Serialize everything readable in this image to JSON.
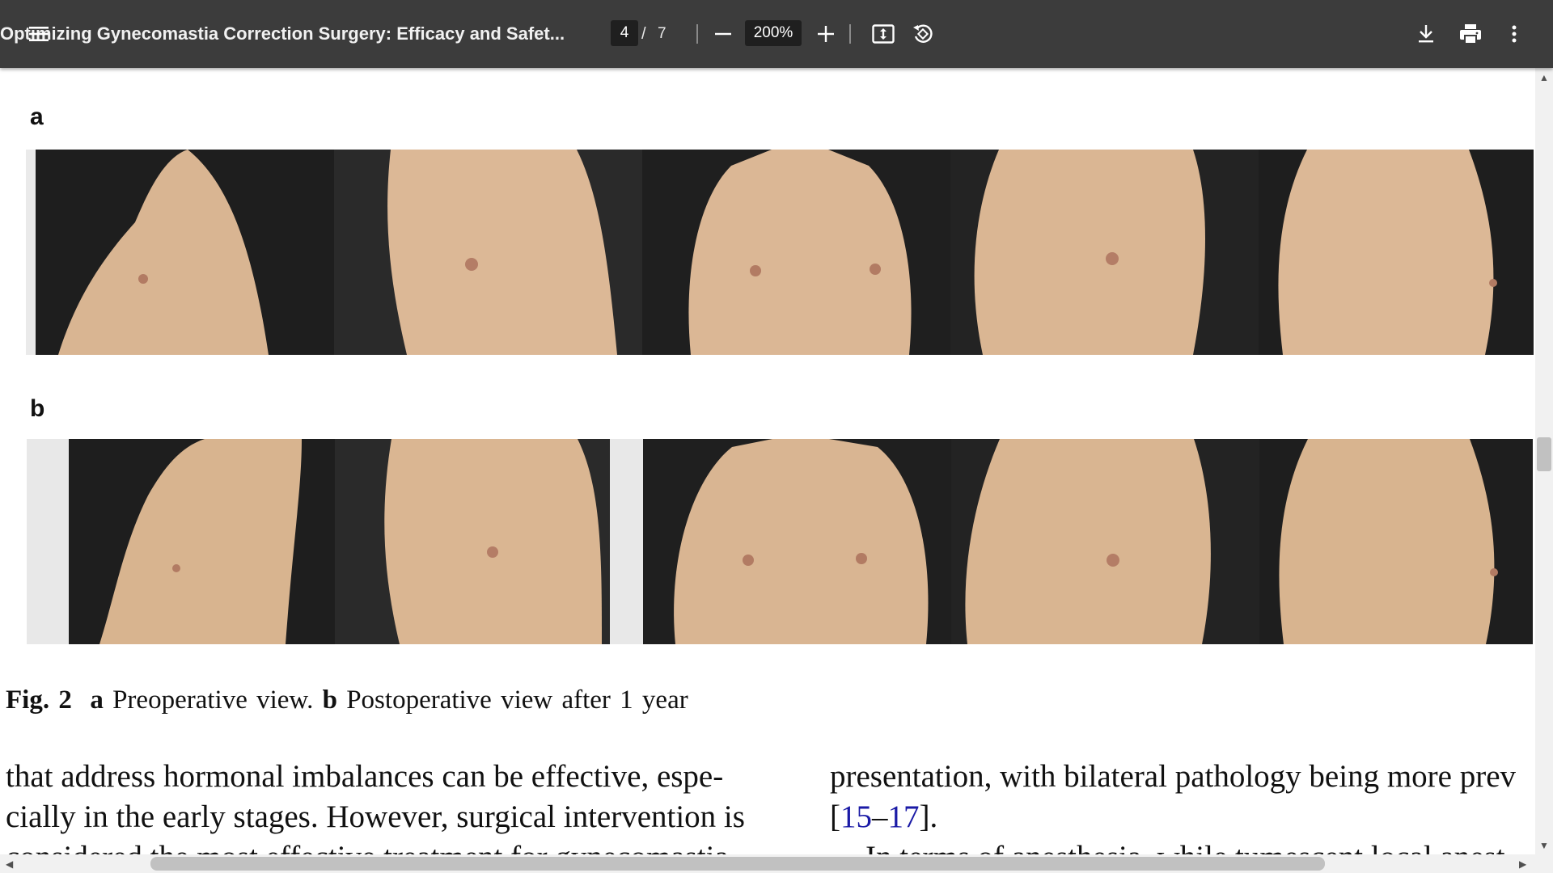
{
  "toolbar": {
    "menu_icon": "hamburger-menu-icon",
    "title": "Optimizing Gynecomastia Correction Surgery: Efficacy and Safet...",
    "current_page": "4",
    "page_separator": "/",
    "total_pages": "7",
    "zoom": "200%",
    "zoom_out_icon": "minus-icon",
    "zoom_in_icon": "plus-icon",
    "fit_icon": "fit-to-page-icon",
    "rotate_icon": "rotate-counterclockwise-icon",
    "download_icon": "download-icon",
    "print_icon": "print-icon",
    "more_icon": "more-vertical-icon",
    "bg_color": "#3c3c3c"
  },
  "figure": {
    "panel_a_label": "a",
    "panel_b_label": "b",
    "caption": {
      "fig": "Fig. 2",
      "a": "a",
      "a_text": "Preoperative view.",
      "b": "b",
      "b_text": "Postoperative view after 1 year"
    }
  },
  "body": {
    "left_col": {
      "line1": "that address hormonal imbalances can be effective, espe-",
      "line2": "cially in the early stages. However, surgical intervention is",
      "line3": "considered the most effective treatment for gynecomastia"
    },
    "right_col": {
      "line1": "presentation, with bilateral pathology being more prev",
      "line2_open": "[",
      "line2_cite1": "15",
      "line2_dash": "–",
      "line2_cite2": "17",
      "line2_close": "].",
      "line3": "In terms of anesthesia, while tumescent local anest"
    }
  }
}
